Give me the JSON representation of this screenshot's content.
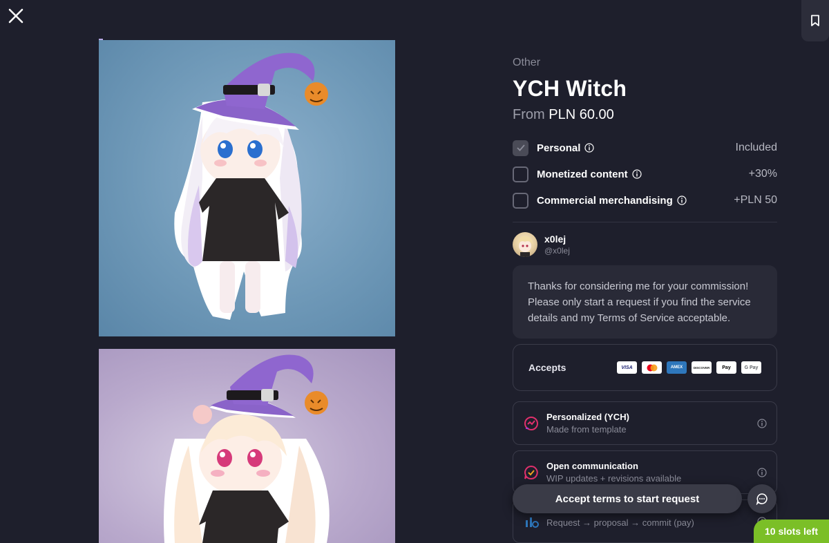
{
  "category": "Other",
  "title": "YCH Witch",
  "price": {
    "from_label": "From",
    "amount": "PLN 60.00"
  },
  "options": [
    {
      "label": "Personal",
      "value": "Included",
      "checked": true
    },
    {
      "label": "Monetized content",
      "value": "+30%",
      "checked": false
    },
    {
      "label": "Commercial merchandising",
      "value": "+PLN 50",
      "checked": false
    }
  ],
  "artist": {
    "name": "x0lej",
    "handle": "@x0lej"
  },
  "message": "Thanks for considering me for your commission! Please only start a request if you find the service details and my Terms of Service acceptable.",
  "accepts": {
    "label": "Accepts",
    "methods": [
      "VISA",
      "Mastercard",
      "AMEX",
      "DISCOVER",
      "Apple Pay",
      "G Pay"
    ]
  },
  "features": [
    {
      "title": "Personalized (YCH)",
      "subtitle": "Made from template",
      "icon": "template-icon"
    },
    {
      "title": "Open communication",
      "subtitle": "WIP updates + revisions available",
      "icon": "chat-check-icon"
    },
    {
      "title": "",
      "subtitle": "Request → proposal → commit (pay)",
      "icon": "process-icon"
    }
  ],
  "cta_label": "Accept terms to start request",
  "slots_label": "10 slots left",
  "colors": {
    "background": "#1e1f2c",
    "slots_badge": "#7bbf27",
    "accent_pink": "#e1306c"
  }
}
